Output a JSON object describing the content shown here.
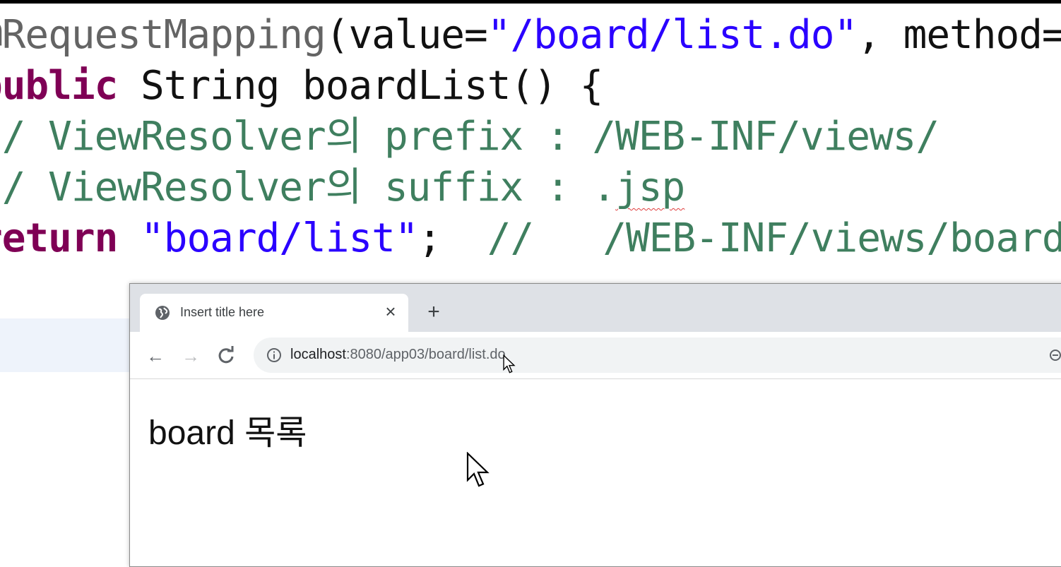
{
  "editor": {
    "lines": [
      [
        {
          "cls": "anno",
          "text": "@RequestMapping"
        },
        {
          "cls": "plain",
          "text": "(value="
        },
        {
          "cls": "str",
          "text": "\"/board/list.do\""
        },
        {
          "cls": "plain",
          "text": ", method=Requ"
        }
      ],
      [
        {
          "cls": "kw",
          "text": "public"
        },
        {
          "cls": "plain",
          "text": " String boardList() {"
        }
      ],
      [
        {
          "cls": "cmt",
          "text": "// ViewResolver의 prefix : /WEB-INF/views/"
        }
      ],
      [
        {
          "cls": "cmt",
          "text": "// ViewResolver의 suffix : ."
        },
        {
          "cls": "cmt squiggle",
          "text": "jsp"
        }
      ],
      [
        {
          "cls": "kw",
          "text": "return"
        },
        {
          "cls": "plain",
          "text": " "
        },
        {
          "cls": "str",
          "text": "\"board/list\""
        },
        {
          "cls": "plain",
          "text": ";  "
        },
        {
          "cls": "cmt",
          "text": "//   /WEB-INF/views/board/l"
        }
      ]
    ]
  },
  "browser": {
    "tab_title": "Insert title here",
    "tab_close": "×",
    "new_tab": "+",
    "nav": {
      "back": "←",
      "forward": "→",
      "reload": "C"
    },
    "url_host": "localhost",
    "url_path": ":8080/app03/board/list.do",
    "page_text": "board 목록"
  },
  "colors": {
    "annotation": "#646464",
    "string": "#2a00ff",
    "keyword": "#7f0055",
    "comment": "#3f7f5f"
  }
}
